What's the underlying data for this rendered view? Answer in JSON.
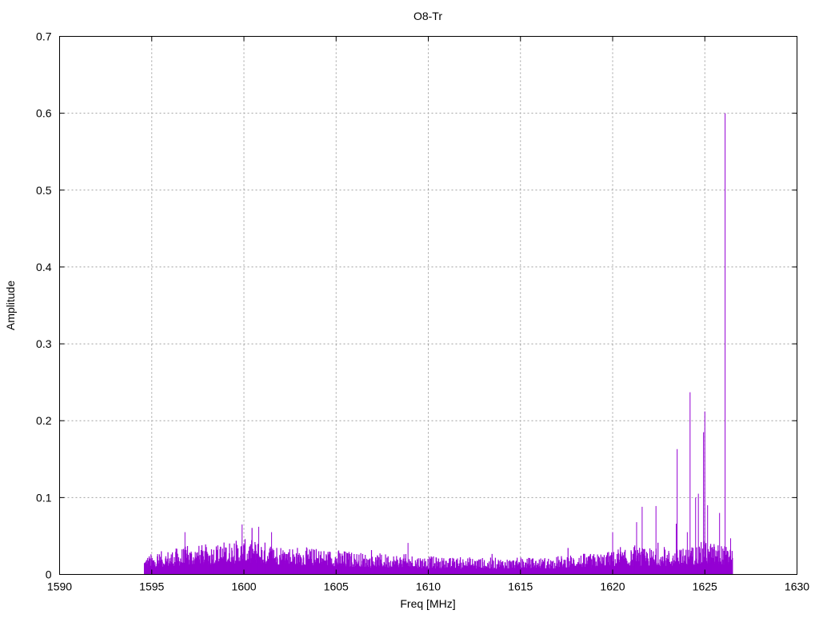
{
  "chart_data": {
    "type": "bar",
    "style": "impulses",
    "title": "O8-Tr",
    "xlabel": "Freq [MHz]",
    "ylabel": "Amplitude",
    "xlim": [
      1590,
      1630
    ],
    "ylim": [
      0,
      0.7
    ],
    "grid": true,
    "xticks": [
      "1590",
      "1595",
      "1600",
      "1605",
      "1610",
      "1615",
      "1620",
      "1625",
      "1630"
    ],
    "yticks": [
      "0",
      "0.1",
      "0.2",
      "0.3",
      "0.4",
      "0.5",
      "0.6",
      "0.7"
    ],
    "color": "#9400d3",
    "data_range": [
      1594.6,
      1626.5
    ],
    "noise_envelope": {
      "x": [
        1594.6,
        1595,
        1596,
        1597,
        1598,
        1599,
        1600,
        1601,
        1602,
        1603,
        1604,
        1605,
        1606,
        1607,
        1608,
        1609,
        1610,
        1611,
        1612,
        1613,
        1614,
        1615,
        1616,
        1617,
        1618,
        1619,
        1620,
        1621,
        1622,
        1623,
        1624,
        1625,
        1626,
        1626.5
      ],
      "y": [
        0.022,
        0.025,
        0.03,
        0.034,
        0.036,
        0.04,
        0.042,
        0.04,
        0.036,
        0.033,
        0.031,
        0.03,
        0.027,
        0.025,
        0.025,
        0.024,
        0.022,
        0.02,
        0.021,
        0.02,
        0.02,
        0.02,
        0.02,
        0.022,
        0.025,
        0.025,
        0.028,
        0.03,
        0.032,
        0.03,
        0.032,
        0.04,
        0.036,
        0.03
      ]
    },
    "peaks": [
      {
        "x": 1626.1,
        "y": 0.6
      },
      {
        "x": 1624.2,
        "y": 0.237
      },
      {
        "x": 1625.0,
        "y": 0.212
      },
      {
        "x": 1624.93,
        "y": 0.185
      },
      {
        "x": 1623.5,
        "y": 0.163
      },
      {
        "x": 1624.65,
        "y": 0.105
      },
      {
        "x": 1624.5,
        "y": 0.1
      },
      {
        "x": 1625.15,
        "y": 0.09
      },
      {
        "x": 1622.35,
        "y": 0.089
      },
      {
        "x": 1621.6,
        "y": 0.088
      },
      {
        "x": 1625.8,
        "y": 0.08
      },
      {
        "x": 1621.3,
        "y": 0.068
      },
      {
        "x": 1623.45,
        "y": 0.066
      },
      {
        "x": 1599.9,
        "y": 0.065
      },
      {
        "x": 1600.8,
        "y": 0.062
      },
      {
        "x": 1596.8,
        "y": 0.055
      },
      {
        "x": 1620.0,
        "y": 0.055
      },
      {
        "x": 1601.5,
        "y": 0.055
      },
      {
        "x": 1624.05,
        "y": 0.055
      },
      {
        "x": 1626.4,
        "y": 0.047
      },
      {
        "x": 1608.9,
        "y": 0.041
      }
    ]
  }
}
